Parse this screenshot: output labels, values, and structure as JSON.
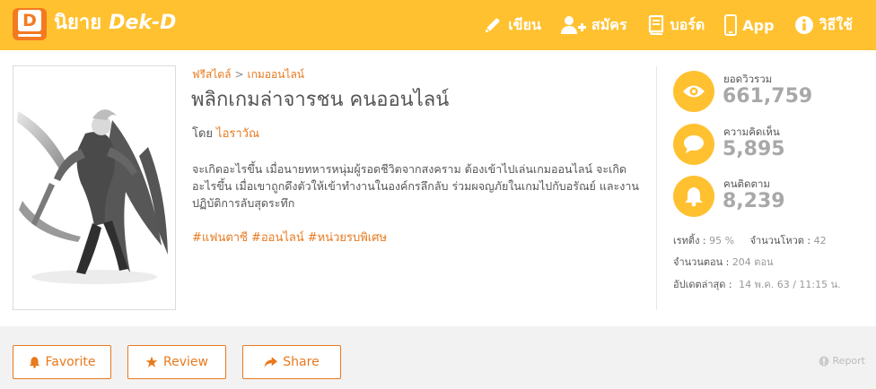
{
  "header": {
    "logo_letter": "D",
    "brand_th": "นิยาย",
    "brand_en": "Dek-D",
    "nav": [
      {
        "label": "เขียน",
        "icon": "pencil-icon"
      },
      {
        "label": "สมัคร",
        "icon": "add-user-icon"
      },
      {
        "label": "บอร์ด",
        "icon": "book-icon"
      },
      {
        "label": "App",
        "icon": "phone-icon"
      },
      {
        "label": "วิธีใช้",
        "icon": "info-icon"
      }
    ]
  },
  "story": {
    "breadcrumb": [
      "ฟรีสไตล์",
      "เกมออนไลน์"
    ],
    "breadcrumb_sep": ">",
    "title": "พลิกเกมล่าจารชน คนออนไลน์",
    "author_prefix": "โดย",
    "author": "ไอราวัณ",
    "synopsis": "จะเกิดอะไรขึ้น เมื่อนายทหารหนุ่มผู้รอดชีวิตจากสงคราม ต้องเข้าไปเล่นเกมออนไลน์ จะเกิดอะไรขึ้น เมื่อเขาถูกดึงตัวให้เข้าทำงานในองค์กรลึกลับ ร่วมผจญภัยในเกมไปกับอรัณย์ และงานปฏิบัติการลับสุดระทึก",
    "tags": [
      "#แฟนตาซี",
      "#ออนไลน์",
      "#หน่วยรบพิเศษ"
    ]
  },
  "stats": {
    "views_label": "ยอดวิวรวม",
    "views": "661,759",
    "comments_label": "ความคิดเห็น",
    "comments": "5,895",
    "followers_label": "คนติดตาม",
    "followers": "8,239",
    "rating_label": "เรทติ้ง :",
    "rating": "95 %",
    "votes_label": "จำนวนโหวต :",
    "votes": "42",
    "chapters_label": "จำนวนตอน :",
    "chapters": "204 ตอน",
    "updated_label": "อัปเดตล่าสุด :",
    "updated": "14 พ.ค. 63 / 11:15 น."
  },
  "actions": {
    "favorite": "Favorite",
    "review": "Review",
    "share": "Share",
    "report": "Report"
  },
  "colors": {
    "brand_yellow": "#ffc130",
    "brand_orange": "#e8791e",
    "logo_orange": "#f47a20"
  }
}
